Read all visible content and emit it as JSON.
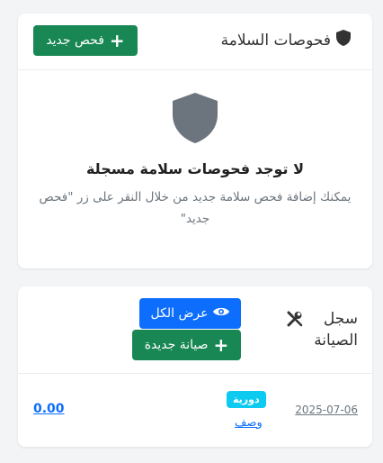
{
  "safety_checks": {
    "title": "فحوصات السلامة",
    "new_button_label": "فحص جديد",
    "empty_state": {
      "title": "لا توجد فحوصات سلامة مسجلة",
      "description": "يمكنك إضافة فحص سلامة جديد من خلال النقر على زر \"فحص جديد\""
    }
  },
  "maintenance_log": {
    "title": "سجل الصيانة",
    "view_all_label": "عرض الكل",
    "new_button_label": "صيانة جديدة",
    "records": [
      {
        "date": "2025-07-06",
        "type_badge": "دورية",
        "description_link": "وصف",
        "amount": "0.00"
      }
    ]
  },
  "colors": {
    "green": "#198754",
    "blue": "#0d6efd",
    "cyan_badge": "#0dcaf0",
    "shield_gray": "#6c757d"
  },
  "icons": [
    "shield-icon",
    "plus-icon",
    "eye-icon",
    "wrench-screwdriver-icon"
  ]
}
